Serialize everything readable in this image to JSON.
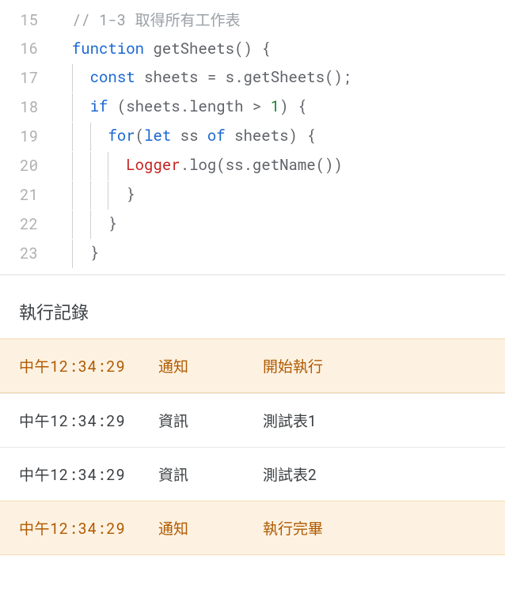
{
  "editor": {
    "lines": [
      {
        "num": "15",
        "indent": 0,
        "guides": 0,
        "tokens": [
          {
            "cls": "tok-comment",
            "t": "// 1-3 取得所有工作表"
          }
        ]
      },
      {
        "num": "16",
        "indent": 0,
        "guides": 0,
        "tokens": [
          {
            "cls": "tok-keyword",
            "t": "function"
          },
          {
            "cls": "",
            "t": " "
          },
          {
            "cls": "tok-func",
            "t": "getSheets"
          },
          {
            "cls": "tok-punct",
            "t": "() {"
          }
        ]
      },
      {
        "num": "17",
        "indent": 1,
        "guides": 1,
        "tokens": [
          {
            "cls": "tok-keyword",
            "t": "const"
          },
          {
            "cls": "",
            "t": " sheets "
          },
          {
            "cls": "tok-operator",
            "t": "="
          },
          {
            "cls": "",
            "t": " s."
          },
          {
            "cls": "tok-func",
            "t": "getSheets"
          },
          {
            "cls": "tok-punct",
            "t": "();"
          }
        ]
      },
      {
        "num": "18",
        "indent": 1,
        "guides": 1,
        "tokens": [
          {
            "cls": "tok-keyword",
            "t": "if"
          },
          {
            "cls": "",
            "t": " (sheets."
          },
          {
            "cls": "tok-func",
            "t": "length"
          },
          {
            "cls": "",
            "t": " "
          },
          {
            "cls": "tok-operator",
            "t": ">"
          },
          {
            "cls": "",
            "t": " "
          },
          {
            "cls": "tok-number",
            "t": "1"
          },
          {
            "cls": "tok-punct",
            "t": ") {"
          }
        ]
      },
      {
        "num": "19",
        "indent": 2,
        "guides": 2,
        "tokens": [
          {
            "cls": "tok-keyword",
            "t": "for"
          },
          {
            "cls": "tok-punct",
            "t": "("
          },
          {
            "cls": "tok-keyword",
            "t": "let"
          },
          {
            "cls": "",
            "t": " ss "
          },
          {
            "cls": "tok-keyword",
            "t": "of"
          },
          {
            "cls": "",
            "t": " sheets"
          },
          {
            "cls": "tok-punct",
            "t": ") {"
          }
        ]
      },
      {
        "num": "20",
        "indent": 3,
        "guides": 3,
        "tokens": [
          {
            "cls": "tok-special",
            "t": "Logger"
          },
          {
            "cls": "tok-punct",
            "t": "."
          },
          {
            "cls": "tok-func",
            "t": "log"
          },
          {
            "cls": "tok-punct",
            "t": "("
          },
          {
            "cls": "",
            "t": "ss."
          },
          {
            "cls": "tok-func",
            "t": "getName"
          },
          {
            "cls": "tok-punct",
            "t": "())"
          }
        ]
      },
      {
        "num": "21",
        "indent": 2,
        "guides": 3,
        "tokens": [
          {
            "cls": "tok-punct",
            "t": "}"
          }
        ]
      },
      {
        "num": "22",
        "indent": 1,
        "guides": 2,
        "tokens": [
          {
            "cls": "tok-punct",
            "t": "}"
          }
        ]
      },
      {
        "num": "23",
        "indent": 0,
        "guides": 1,
        "tokens": [
          {
            "cls": "tok-punct",
            "t": "}"
          }
        ]
      }
    ]
  },
  "log": {
    "title": "執行記錄",
    "rows": [
      {
        "time": "中午12:34:29",
        "type": "通知",
        "msg": "開始執行",
        "level": "notice"
      },
      {
        "time": "中午12:34:29",
        "type": "資訊",
        "msg": "測試表1",
        "level": "info"
      },
      {
        "time": "中午12:34:29",
        "type": "資訊",
        "msg": "測試表2",
        "level": "info"
      },
      {
        "time": "中午12:34:29",
        "type": "通知",
        "msg": "執行完畢",
        "level": "notice"
      }
    ]
  }
}
